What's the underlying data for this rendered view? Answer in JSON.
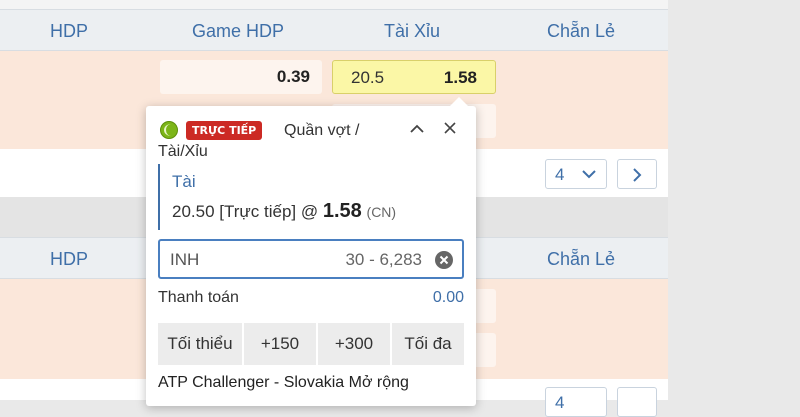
{
  "columns": [
    "HDP",
    "Game HDP",
    "Tài Xỉu",
    "Chẵn Lẻ"
  ],
  "row1": {
    "game_hdp_odds": "0.39",
    "tai_xiu_handicap": "20.5",
    "tai_xiu_odds": "1.58"
  },
  "pager": {
    "selected": "4"
  },
  "pager2": {
    "selected": "4"
  },
  "betslip": {
    "live_badge": "TRỰC TIẾP",
    "sport": "Quần vợt /",
    "market": "Tài/Xỉu",
    "selection": "Tài",
    "line_prefix": "20.50 [Trực tiếp] @",
    "odds": "1.58",
    "odds_format": "(CN)",
    "stake_placeholder": "INH",
    "stake_range": "30 - 6,283",
    "payout_label": "Thanh toán",
    "payout_value": "0.00",
    "quick_buttons": [
      "Tối thiểu",
      "+150",
      "+300",
      "Tối đa"
    ],
    "league": "ATP Challenger - Slovakia Mở rộng"
  },
  "colors": {
    "accent": "#3f6fa8",
    "live": "#cc2a24",
    "highlight": "#fbf7a6",
    "row_bg": "#fbe7da"
  },
  "icons": [
    "tennis-ball-icon",
    "chevron-up-icon",
    "close-icon",
    "clear-icon",
    "chevron-down-icon",
    "chevron-right-icon"
  ]
}
